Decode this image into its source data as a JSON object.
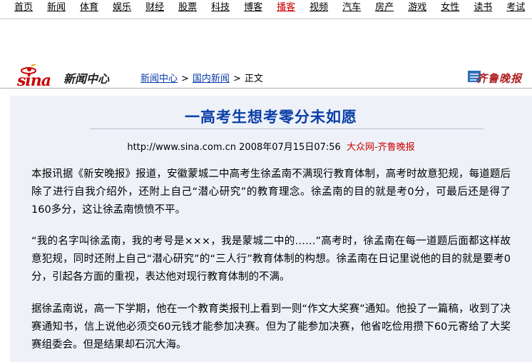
{
  "topnav": {
    "items": [
      "首页",
      "新闻",
      "体育",
      "娱乐",
      "财经",
      "股票",
      "科技",
      "博客",
      "播客",
      "视频",
      "汽车",
      "房产",
      "游戏",
      "女性",
      "读书",
      "考试"
    ],
    "highlight_index": 8
  },
  "header": {
    "logo_text": "sina",
    "site_name": "新闻中心",
    "breadcrumb": {
      "home": "新闻中心",
      "sep1": ">",
      "section": "国内新闻",
      "sep2": ">",
      "current": "正文"
    },
    "paper_logo_text": "齐鲁晚报"
  },
  "article": {
    "title": "一高考生想考零分未如愿",
    "meta_url": "http://www.sina.com.cn",
    "meta_date": "2008年07月15日07:56",
    "meta_source": "大众网-齐鲁晚报",
    "paragraphs": [
      "本报讯据《新安晚报》报道，安徽蒙城二中高考生徐孟南不满现行教育体制，高考时故意犯规，每道题后除了进行自我介绍外，还附上自己“潜心研究”的教育理念。徐孟南的目的就是考0分，可最后还是得了160多分，这让徐孟南愤愤不平。",
      "“我的名字叫徐孟南，我的考号是×××，我是蒙城二中的……”高考时，徐孟南在每一道题后面都这样故意犯规，同时还附上自己“潜心研究”的“三人行”教育体制的构想。徐孟南在日记里说他的目的就是要考0分，引起各方面的重视，表达他对现行教育体制的不满。",
      "据徐孟南说，高一下学期，他在一个教育类报刊上看到一则“作文大奖赛”通知。他投了一篇稿，收到了决赛通知书，信上说他必须交60元钱才能参加决赛。但为了能参加决赛，他省吃俭用攒下60元寄给了大奖赛组委会。但是结果却石沉大海。"
    ]
  },
  "colors": {
    "brand_red": "#cc0000",
    "link_blue": "#0b3ea8",
    "article_bg": "#eef2f8"
  }
}
